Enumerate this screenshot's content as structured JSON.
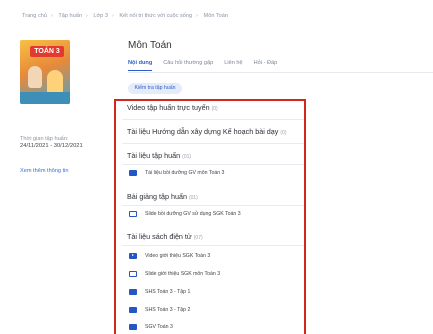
{
  "breadcrumb": [
    "Trang chủ",
    "Tập huấn",
    "Lớp 3",
    "Kết nối tri thức với cuộc sống",
    "Môn Toán"
  ],
  "book": {
    "cover_text": "TOÁN 3"
  },
  "sidebar": {
    "time_label": "Thời gian tập huấn:",
    "time_value": "24/11/2021 - 30/12/2021",
    "more_link": "Xem thêm thông tin"
  },
  "main": {
    "title": "Môn Toán",
    "tabs": [
      {
        "label": "Nội dung",
        "active": true
      },
      {
        "label": "Câu hỏi thường gặp",
        "active": false
      },
      {
        "label": "Liên hệ",
        "active": false
      },
      {
        "label": "Hỏi - Đáp",
        "active": false
      }
    ],
    "pill_label": "Kiểm tra tập huấn"
  },
  "sections": [
    {
      "title": "Video tập huấn trực tuyến",
      "count": "(0)",
      "items": []
    },
    {
      "title": "Tài liệu Hướng dẫn xây dựng Kế hoạch bài dạy",
      "count": "(0)",
      "items": []
    },
    {
      "title": "Tài liệu tập huấn",
      "count": "(01)",
      "items": [
        {
          "label": "Tài liệu bồi dưỡng GV môn Toán 3",
          "icon": "document-icon"
        }
      ]
    },
    {
      "title": "Bài giảng tập huấn",
      "count": "(01)",
      "items": [
        {
          "label": "Slide bồi dưỡng GV sử dụng SGK Toán 3",
          "icon": "slide-icon"
        }
      ]
    },
    {
      "title": "Tài liệu sách điện tử",
      "count": "(07)",
      "items": [
        {
          "label": "Video giới thiệu SGK Toán 3",
          "icon": "video-icon"
        },
        {
          "label": "Slide giới thiệu SGK môn Toán 3",
          "icon": "slide-icon"
        },
        {
          "label": "SHS Toán 3 - Tập 1",
          "icon": "book-icon"
        },
        {
          "label": "SHS Toán 3 - Tập 2",
          "icon": "book-icon"
        },
        {
          "label": "SGV Toán 3",
          "icon": "book-icon"
        }
      ]
    }
  ],
  "colors": {
    "accent": "#2c5cc5",
    "highlight_frame": "#d0281f",
    "icon": "#2456c4"
  }
}
